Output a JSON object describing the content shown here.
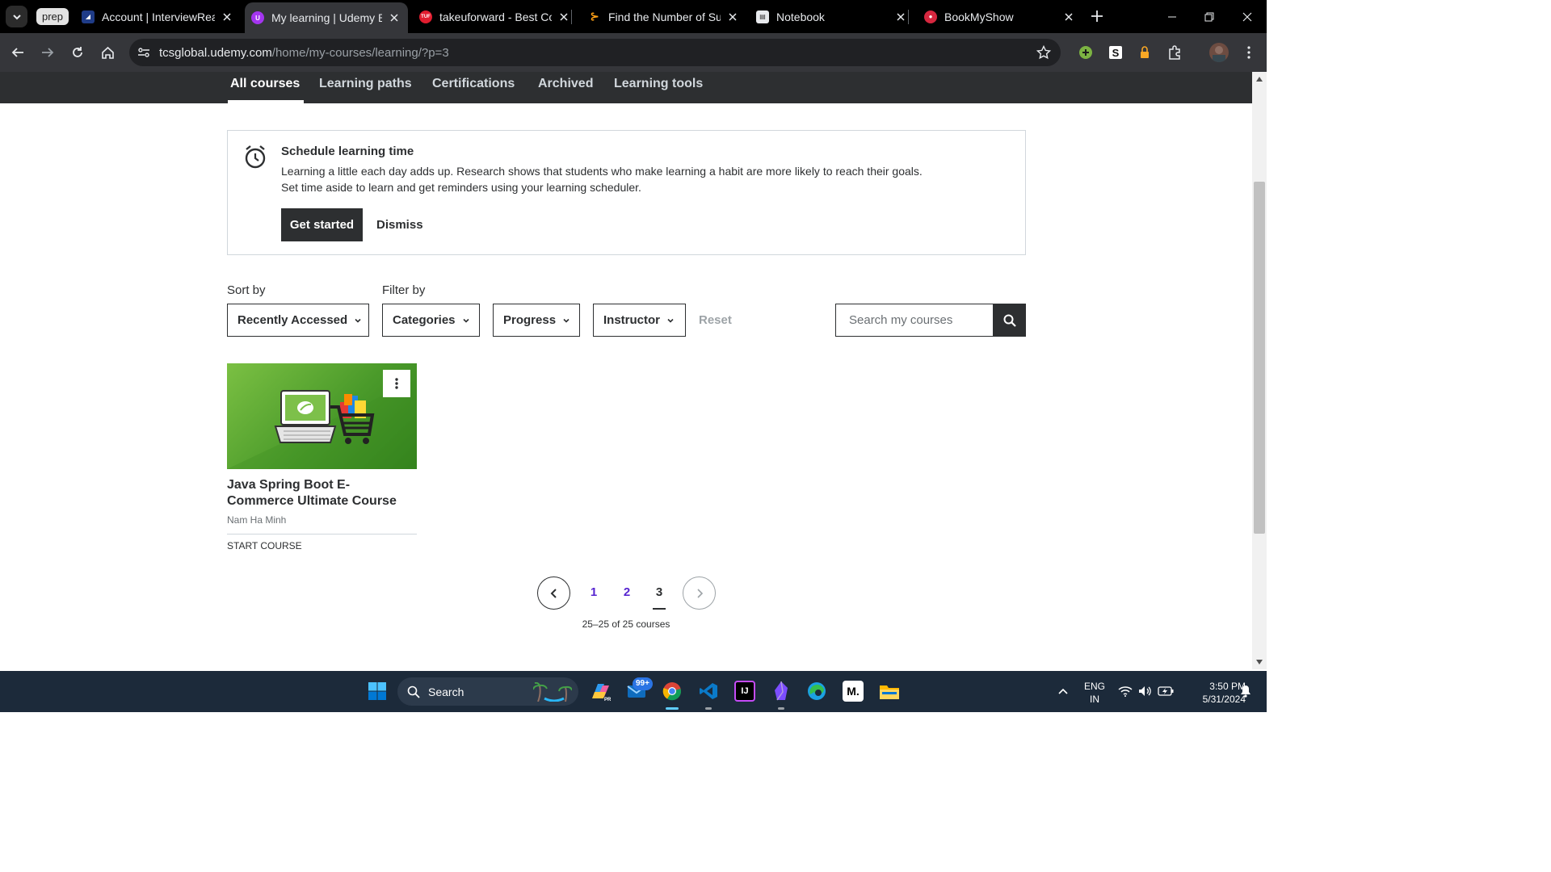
{
  "browser": {
    "tab_group_label": "prep",
    "tabs": [
      {
        "title": "Account | InterviewReady",
        "favicon": "interviewready-icon",
        "active": false
      },
      {
        "title": "My learning | Udemy Business",
        "favicon": "udemy-icon",
        "active": true
      },
      {
        "title": "takeuforward - Best Coding",
        "favicon": "takeuforward-icon",
        "favicon_text": "TUF",
        "active": false
      },
      {
        "title": "Find the Number of Subarrays",
        "favicon": "leetcode-icon",
        "active": false
      },
      {
        "title": "Notebook",
        "favicon": "notebook-icon",
        "active": false
      },
      {
        "title": "BookMyShow",
        "favicon": "bookmyshow-icon",
        "active": false
      }
    ],
    "url_host": "tcsglobal.udemy.com",
    "url_path": "/home/my-courses/learning/?p=3"
  },
  "subnav": {
    "tabs": [
      "All courses",
      "Learning paths",
      "Certifications",
      "Archived",
      "Learning tools"
    ],
    "active_index": 0
  },
  "banner": {
    "title": "Schedule learning time",
    "line1": "Learning a little each day adds up. Research shows that students who make learning a habit are more likely to reach their goals.",
    "line2": "Set time aside to learn and get reminders using your learning scheduler.",
    "primary_button": "Get started",
    "secondary_button": "Dismiss"
  },
  "filters": {
    "sort_label": "Sort by",
    "filter_label": "Filter by",
    "sort_value": "Recently Accessed",
    "dropdowns": [
      "Categories",
      "Progress",
      "Instructor"
    ],
    "reset_label": "Reset",
    "search_placeholder": "Search my courses"
  },
  "courses": [
    {
      "title": "Java Spring Boot E-Commerce Ultimate Course",
      "title_line1": "Java Spring Boot E-",
      "title_line2": "Commerce Ultimate Course",
      "instructor": "Nam Ha Minh",
      "cta": "START COURSE"
    }
  ],
  "pagination": {
    "pages": [
      "1",
      "2",
      "3"
    ],
    "current": "3",
    "summary": "25–25 of 25 courses"
  },
  "taskbar": {
    "search_label": "Search",
    "mail_badge": "99+",
    "language": "ENG",
    "region": "IN",
    "time": "3:50 PM",
    "date": "5/31/2024"
  },
  "colors": {
    "udemy_dark": "#2d2f31",
    "udemy_purple": "#5624d0",
    "chrome_bg": "#35363a"
  }
}
